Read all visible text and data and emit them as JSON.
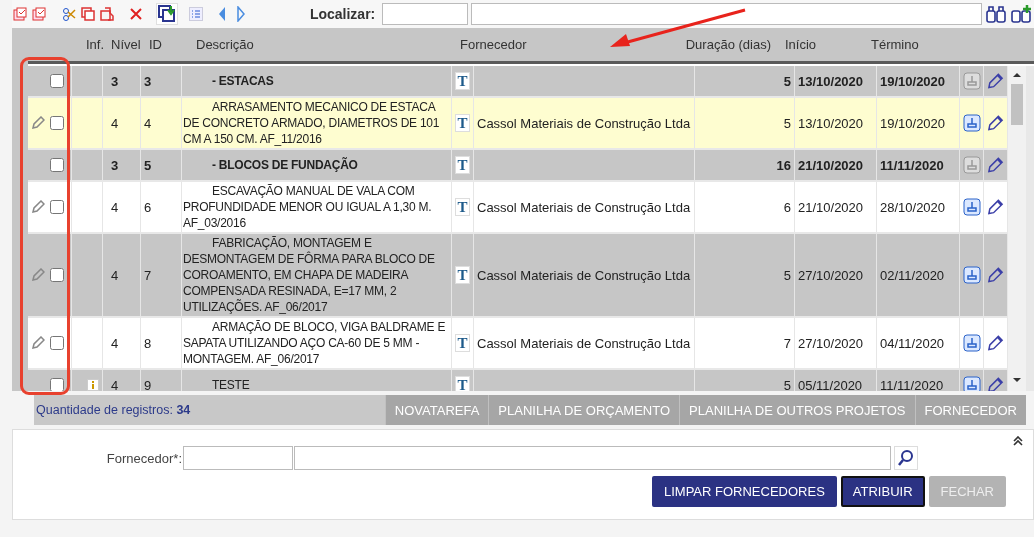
{
  "toolbar": {
    "search_label": "Localizar:"
  },
  "columns": [
    "Inf.",
    "Nível",
    "ID",
    "Descrição",
    "Fornecedor",
    "Duração (dias)",
    "Início",
    "Término"
  ],
  "rows": [
    {
      "kind": "group",
      "selected": false,
      "edit_mark": false,
      "info": false,
      "nivel": "3",
      "id": "3",
      "description": "- ESTACAS",
      "note_glyph": "T",
      "supplier": "",
      "duration": "5",
      "start": "13/10/2020",
      "end": "19/10/2020",
      "stamp_enabled": false
    },
    {
      "kind": "item",
      "selected": true,
      "edit_mark": true,
      "info": false,
      "nivel": "4",
      "id": "4",
      "description": "ARRASAMENTO MECANICO DE ESTACA DE CONCRETO ARMADO, DIAMETROS DE 101 CM A 150 CM. AF_11/2016",
      "note_glyph": "T",
      "supplier": "Cassol Materiais de Construção Ltda",
      "duration": "5",
      "start": "13/10/2020",
      "end": "19/10/2020",
      "stamp_enabled": true
    },
    {
      "kind": "group",
      "selected": false,
      "edit_mark": false,
      "info": false,
      "nivel": "3",
      "id": "5",
      "description": "- BLOCOS DE FUNDAÇÃO",
      "note_glyph": "T",
      "supplier": "",
      "duration": "16",
      "start": "21/10/2020",
      "end": "11/11/2020",
      "stamp_enabled": false
    },
    {
      "kind": "item",
      "selected": false,
      "edit_mark": true,
      "info": false,
      "nivel": "4",
      "id": "6",
      "description": "ESCAVAÇÃO MANUAL DE VALA COM PROFUNDIDADE MENOR OU IGUAL A 1,30 M. AF_03/2016",
      "note_glyph": "T",
      "supplier": "Cassol Materiais de Construção Ltda",
      "duration": "6",
      "start": "21/10/2020",
      "end": "28/10/2020",
      "stamp_enabled": true
    },
    {
      "kind": "item",
      "selected": false,
      "edit_mark": true,
      "info": false,
      "nivel": "4",
      "id": "7",
      "description": "FABRICAÇÃO, MONTAGEM E DESMONTAGEM DE FÔRMA PARA BLOCO DE COROAMENTO, EM CHAPA DE MADEIRA COMPENSADA RESINADA, E=17 MM, 2 UTILIZAÇÕES. AF_06/2017",
      "note_glyph": "T",
      "supplier": "Cassol Materiais de Construção Ltda",
      "duration": "5",
      "start": "27/10/2020",
      "end": "02/11/2020",
      "stamp_enabled": true
    },
    {
      "kind": "item",
      "selected": false,
      "edit_mark": true,
      "info": false,
      "nivel": "4",
      "id": "8",
      "description": "ARMAÇÃO DE BLOCO, VIGA BALDRAME E SAPATA UTILIZANDO AÇO CA-60 DE 5 MM - MONTAGEM. AF_06/2017",
      "note_glyph": "T",
      "supplier": "Cassol Materiais de Construção Ltda",
      "duration": "7",
      "start": "27/10/2020",
      "end": "04/11/2020",
      "stamp_enabled": true
    },
    {
      "kind": "item",
      "selected": false,
      "edit_mark": false,
      "info": true,
      "nivel": "4",
      "id": "9",
      "description": "TESTE",
      "note_glyph": "T",
      "supplier": "",
      "duration": "5",
      "start": "05/11/2020",
      "end": "11/11/2020",
      "stamp_enabled": true
    }
  ],
  "footer": {
    "count_label": "Quantidade de registros:",
    "count": "34",
    "tabs": [
      "NOVATAREFA",
      "PLANILHA DE ORÇAMENTO",
      "PLANILHA DE OUTROS PROJETOS",
      "FORNECEDOR"
    ]
  },
  "form": {
    "label": "Fornecedor*:",
    "buttons": [
      {
        "label": "LIMPAR FORNECEDORES",
        "focused": false,
        "disabled": false
      },
      {
        "label": "ATRIBUIR",
        "focused": true,
        "disabled": false
      },
      {
        "label": "FECHAR",
        "focused": false,
        "disabled": true
      }
    ]
  }
}
